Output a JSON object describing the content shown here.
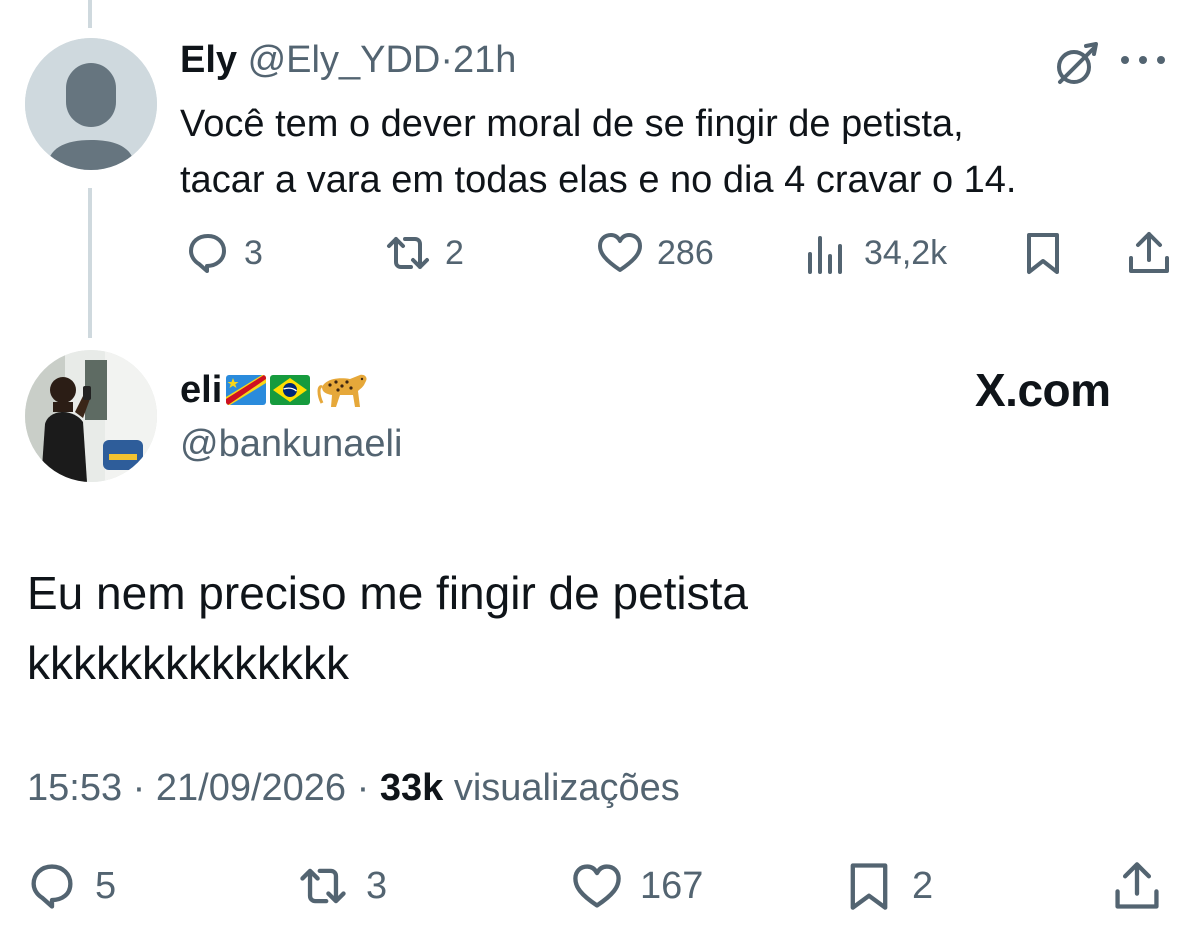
{
  "reply": {
    "name": "Ely",
    "handle": "@Ely_YDD",
    "separator": "·",
    "time": "21h",
    "text_line1": "Você tem o dever moral de se fingir de petista,",
    "text_line2": "tacar a vara em todas elas e no dia 4 cravar o 14.",
    "stats": {
      "replies": "3",
      "reposts": "2",
      "likes": "286",
      "views": "34,2k"
    }
  },
  "main": {
    "name": "eli",
    "emojis": [
      "flag-dr-congo",
      "flag-brazil",
      "leopard"
    ],
    "handle": "@bankunaeli",
    "watermark": "X.com",
    "text_line1": "Eu nem preciso me fingir de petista",
    "text_line2": "kkkkkkkkkkkkkk",
    "time": "15:53",
    "date": "21/09/2026",
    "separator": "·",
    "views_count": "33k",
    "views_label": "visualizações",
    "stats": {
      "replies": "5",
      "reposts": "3",
      "likes": "167",
      "bookmarks": "2"
    }
  },
  "colors": {
    "text": "#0f1419",
    "muted": "#536471",
    "thread_line": "#cfd9de"
  }
}
